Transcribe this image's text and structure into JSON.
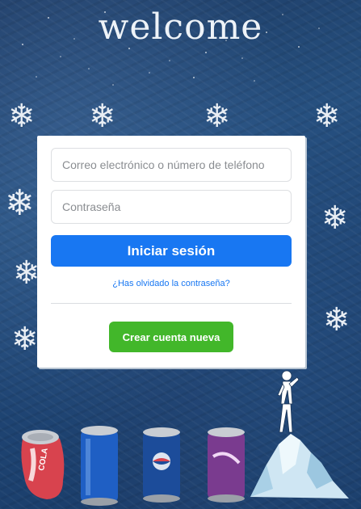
{
  "header": {
    "title": "welcome"
  },
  "login_form": {
    "email_placeholder": "Correo electrónico o número de teléfono",
    "password_placeholder": "Contraseña",
    "login_button": "Iniciar sesión",
    "forgot_link": "¿Has olvidado la contraseña?",
    "create_account_button": "Crear cuenta nueva"
  },
  "decorations": {
    "snowflake_glyph": "❄",
    "cans": [
      {
        "name": "red-cola-can",
        "label": "COLA",
        "color": "#d8434e"
      },
      {
        "name": "blue-can",
        "label": "",
        "color": "#1f5fc4"
      },
      {
        "name": "blue-pepsi-can",
        "label": "",
        "color": "#1c4c9a"
      },
      {
        "name": "purple-can",
        "label": "",
        "color": "#7a3b8f"
      }
    ],
    "figure": "person-drinking-on-iceberg"
  },
  "colors": {
    "primary_blue": "#1877f2",
    "create_green": "#42b72a",
    "background": "#1f4574"
  }
}
